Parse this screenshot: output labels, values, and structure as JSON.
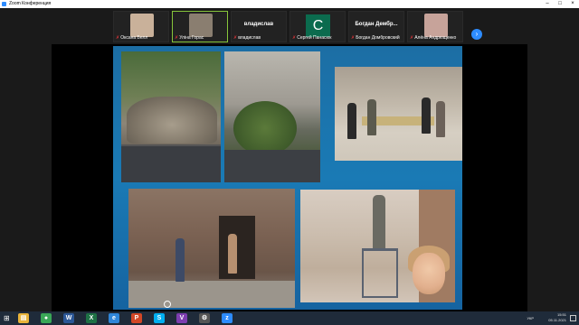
{
  "window": {
    "title": "Zoom Конференция",
    "controls": [
      "–",
      "□",
      "×"
    ]
  },
  "participants": [
    {
      "name": "Оксана Белл",
      "muted": true,
      "type": "photo",
      "photo_color": "#c9b19a"
    },
    {
      "name": "Уліна Горас",
      "muted": true,
      "type": "photo",
      "photo_color": "#8a7e70",
      "active": true
    },
    {
      "name": "владислав",
      "muted": true,
      "type": "name",
      "center_label": "владислав"
    },
    {
      "name": "Сергей Панасюк",
      "muted": true,
      "type": "initial",
      "initial": "С"
    },
    {
      "name": "Богдан Домбровский",
      "muted": true,
      "type": "name",
      "center_label": "Богдан Дембр..."
    },
    {
      "name": "Алёна Андрющенко",
      "muted": true,
      "type": "photo",
      "photo_color": "#c7a39a"
    }
  ],
  "strip_next_icon": "chevron-right-icon",
  "taskbar": {
    "apps": [
      {
        "name": "file-explorer-icon",
        "glyph": "▤",
        "color": "#e8b33a"
      },
      {
        "name": "chrome-icon",
        "glyph": "●",
        "color": "#3aa757"
      },
      {
        "name": "word-icon",
        "glyph": "W",
        "color": "#2b5797"
      },
      {
        "name": "excel-icon",
        "glyph": "X",
        "color": "#1e7145"
      },
      {
        "name": "edge-icon",
        "glyph": "e",
        "color": "#2f86d9"
      },
      {
        "name": "powerpoint-icon",
        "glyph": "P",
        "color": "#d24726"
      },
      {
        "name": "skype-icon",
        "glyph": "S",
        "color": "#00aff0"
      },
      {
        "name": "viber-icon",
        "glyph": "V",
        "color": "#7d3daf"
      },
      {
        "name": "settings-icon",
        "glyph": "⚙",
        "color": "#555"
      },
      {
        "name": "zoom-icon",
        "glyph": "z",
        "color": "#2d8cff"
      }
    ],
    "language": "УКР",
    "time": "15:51",
    "date": "05.11.2021"
  }
}
